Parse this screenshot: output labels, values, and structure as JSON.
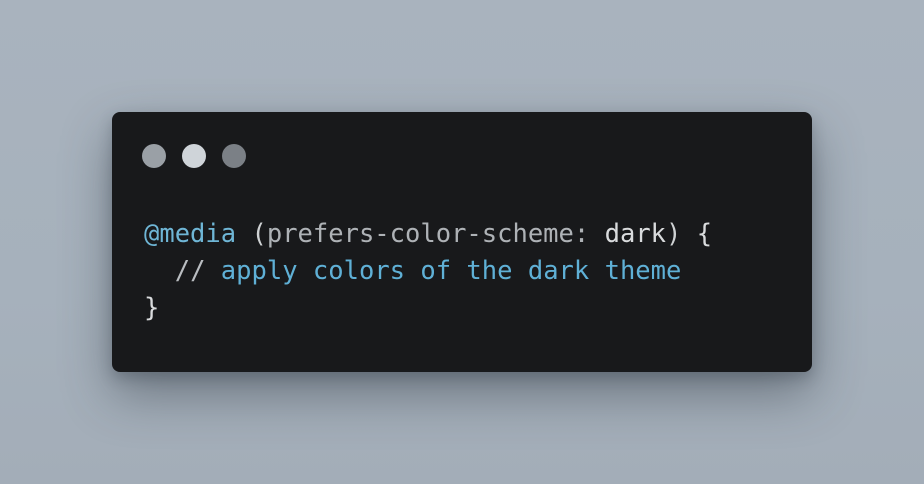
{
  "window": {
    "title_dots": [
      "close",
      "minimize",
      "maximize"
    ]
  },
  "code": {
    "line1": {
      "at_rule": "@media",
      "open_paren": "(",
      "feature": "prefers-color-scheme:",
      "value": "dark",
      "close_paren": ")",
      "open_brace": "{"
    },
    "line2": {
      "comment_marker": "//",
      "comment_text": "apply colors of the dark theme"
    },
    "line3": {
      "close_brace": "}"
    }
  },
  "colors": {
    "background": "#a6b1bc",
    "window": "#18191b",
    "keyword": "#6fb6d6",
    "comment": "#5fb0d6",
    "text": "#d6d8da"
  }
}
